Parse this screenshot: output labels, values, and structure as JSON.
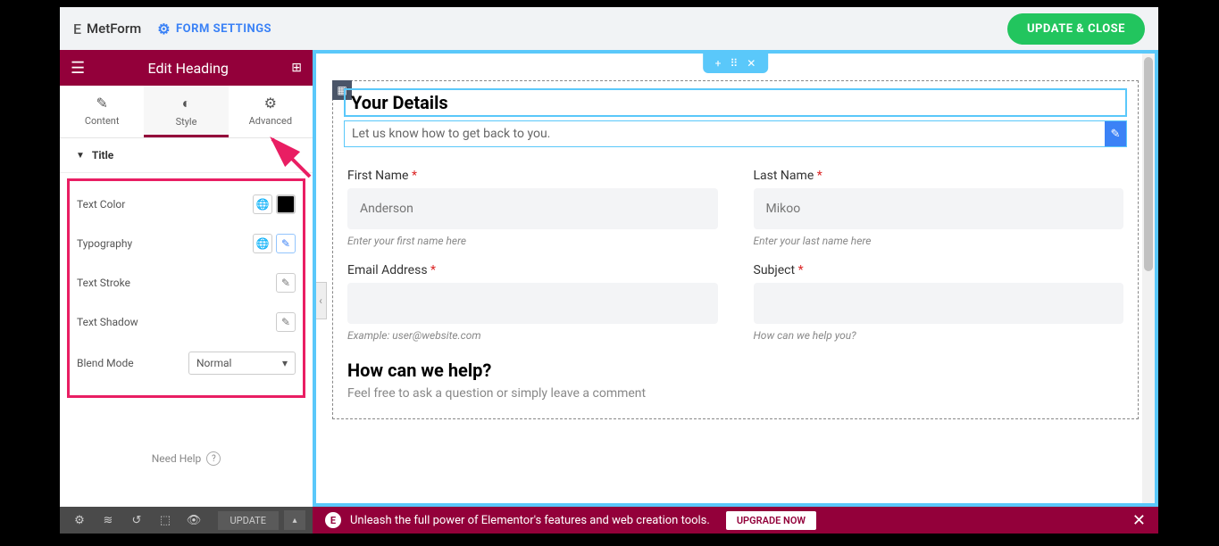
{
  "topbar": {
    "brand": "MetForm",
    "form_settings": "FORM SETTINGS",
    "update_close": "UPDATE & CLOSE"
  },
  "sidebar": {
    "title": "Edit Heading",
    "tabs": {
      "content": "Content",
      "style": "Style",
      "advanced": "Advanced"
    },
    "section": "Title",
    "controls": {
      "text_color": "Text Color",
      "typography": "Typography",
      "text_stroke": "Text Stroke",
      "text_shadow": "Text Shadow",
      "blend_mode": "Blend Mode",
      "blend_value": "Normal"
    },
    "need_help": "Need Help"
  },
  "form": {
    "heading": "Your Details",
    "subheading": "Let us know how to get back to you.",
    "first_name": {
      "label": "First Name",
      "placeholder": "Anderson",
      "hint": "Enter your first name here"
    },
    "last_name": {
      "label": "Last Name",
      "placeholder": "Mikoo",
      "hint": "Enter your last name here"
    },
    "email": {
      "label": "Email Address",
      "hint": "Example: user@website.com"
    },
    "subject": {
      "label": "Subject",
      "hint": "How can we help you?"
    },
    "section2": {
      "title": "How can we help?",
      "sub": "Feel free to ask a question or simply leave a comment"
    }
  },
  "footer": {
    "update": "UPDATE",
    "banner": "Unleash the full power of Elementor's features and web creation tools.",
    "upgrade": "UPGRADE NOW"
  }
}
